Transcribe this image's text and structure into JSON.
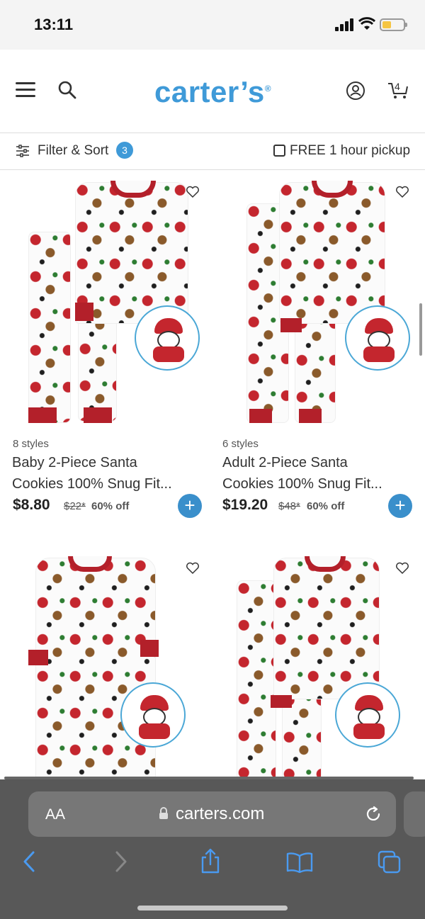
{
  "status_bar": {
    "time": "13:11"
  },
  "header": {
    "logo": "carter’s",
    "cart_count": "4"
  },
  "filter_bar": {
    "filter_label": "Filter & Sort",
    "filter_count": "3",
    "pickup_label": "FREE 1 hour pickup"
  },
  "products": [
    {
      "styles": "8 styles",
      "title_line1": "Baby 2-Piece Santa",
      "title_line2": "Cookies 100% Snug Fit...",
      "price": "$8.80",
      "original_price": "$22*",
      "discount": "60% off",
      "add_label": "+"
    },
    {
      "styles": "6 styles",
      "title_line1": "Adult 2-Piece Santa",
      "title_line2": "Cookies 100% Snug Fit...",
      "price": "$19.20",
      "original_price": "$48*",
      "discount": "60% off",
      "add_label": "+"
    }
  ],
  "browser": {
    "text_size_label": "AA",
    "url": "carters.com"
  },
  "colors": {
    "brand_blue": "#3f9ad8",
    "pajama_red": "#b3202a",
    "chrome_gray": "#585858"
  },
  "icons": [
    "menu-icon",
    "search-icon",
    "account-icon",
    "cart-icon",
    "filter-icon",
    "heart-icon",
    "lock-icon",
    "reload-icon",
    "back-icon",
    "forward-icon",
    "share-icon",
    "bookmarks-icon",
    "tabs-icon"
  ]
}
